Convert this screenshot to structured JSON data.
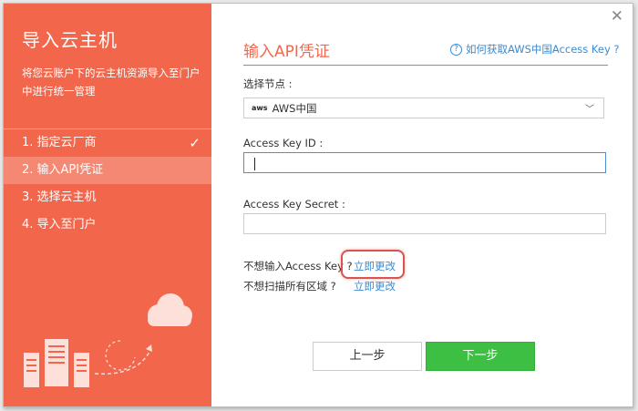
{
  "sidebar": {
    "title": "导入云主机",
    "description": "将您云账户下的云主机资源导入至门户中进行统一管理",
    "steps": [
      {
        "label": "1. 指定云厂商",
        "done": true
      },
      {
        "label": "2. 输入API凭证",
        "active": true
      },
      {
        "label": "3. 选择云主机"
      },
      {
        "label": "4. 导入至门户"
      }
    ],
    "check_glyph": "✓"
  },
  "main": {
    "title": "输入API凭证",
    "help_link": "如何获取AWS中国Access Key ?",
    "node_label": "选择节点 :",
    "node_value": "AWS中国",
    "node_logo": "aws",
    "access_key_id_label": "Access Key ID :",
    "access_key_id_value": "",
    "access_key_secret_label": "Access Key Secret :",
    "access_key_secret_value": "",
    "no_key_question": "不想输入Access Key ?",
    "no_key_link": "立即更改",
    "no_scan_question": "不想扫描所有区域 ?",
    "no_scan_link": "立即更改"
  },
  "footer": {
    "prev_label": "上一步",
    "next_label": "下一步"
  },
  "colors": {
    "accent": "#f2674c",
    "link": "#3a8ad0",
    "primary_button": "#3cbf43"
  }
}
